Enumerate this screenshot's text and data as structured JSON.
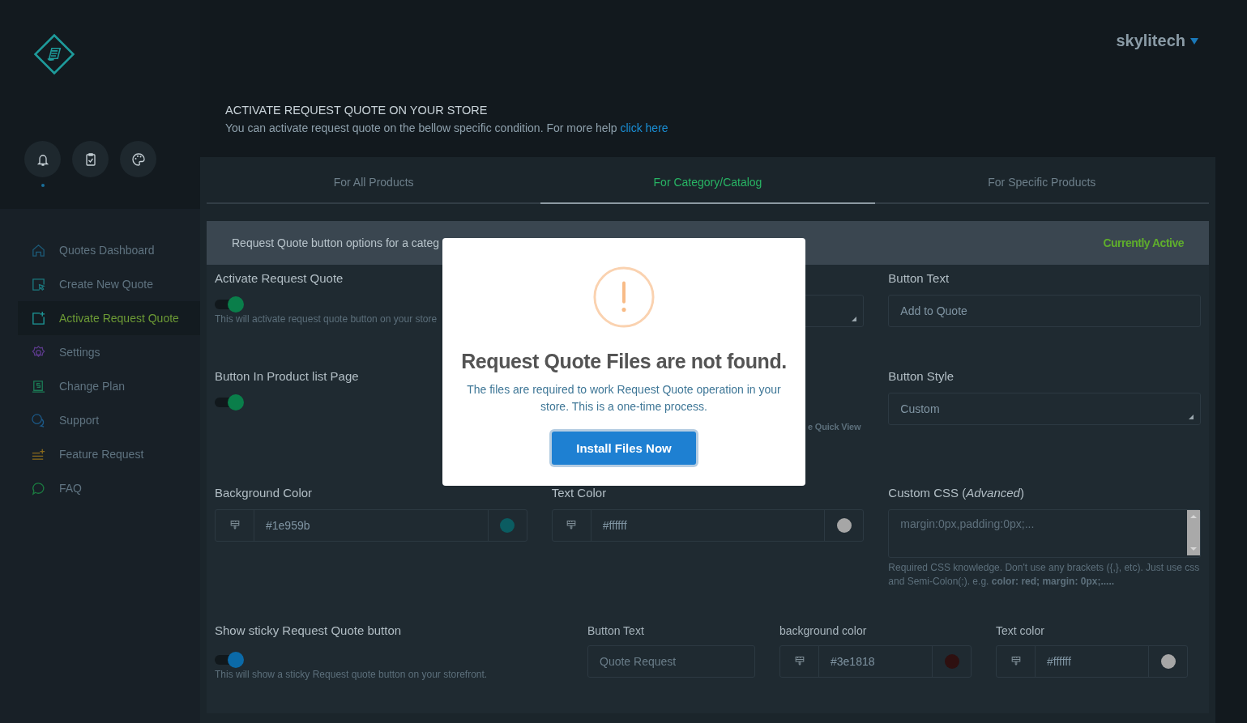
{
  "account": {
    "user": "skylitech"
  },
  "quick_actions": [
    {
      "kind": "bell",
      "notified": true
    },
    {
      "kind": "clipboard",
      "notified": false
    },
    {
      "kind": "palette",
      "notified": false
    }
  ],
  "sidebar": {
    "items": [
      {
        "label": "Quotes Dashboard",
        "kind": "home",
        "selected": false
      },
      {
        "label": "Create New Quote",
        "kind": "select",
        "selected": false
      },
      {
        "label": "Activate Request Quote",
        "kind": "adddoc",
        "selected": true
      },
      {
        "label": "Settings",
        "kind": "gear",
        "selected": false
      },
      {
        "label": "Change Plan",
        "kind": "plan",
        "selected": false
      },
      {
        "label": "Support",
        "kind": "chat",
        "selected": false
      },
      {
        "label": "Feature Request",
        "kind": "list",
        "selected": false
      },
      {
        "label": "FAQ",
        "kind": "bubble",
        "selected": false
      }
    ]
  },
  "header": {
    "title": "ACTIVATE REQUEST QUOTE ON YOUR STORE",
    "subtitle": "You can activate request quote on the bellow specific condition. For more help",
    "link": "click here"
  },
  "tabs": [
    {
      "label": "For All Products",
      "selected": false
    },
    {
      "label": "For Category/Catalog",
      "selected": true
    },
    {
      "label": "For Specific Products",
      "selected": false
    }
  ],
  "section": {
    "title": "Request Quote button options for a categ",
    "status": "Currently Active"
  },
  "settings": [
    {
      "kind": "toggle",
      "label": "Activate Request Quote",
      "on": true,
      "color": "#0a7e4a",
      "hint": "This will activate request quote button on your store"
    },
    {
      "kind": "select"
    },
    {
      "kind": "text",
      "label": "Button Text",
      "value": "Add to Quote"
    },
    {
      "kind": "toggle",
      "label": "Button In Product list Page",
      "on": true,
      "color": "#0a7e4a"
    },
    {
      "kind": "note",
      "text": "e Quick View"
    },
    {
      "kind": "select",
      "label": "Button Style",
      "value": "Custom"
    },
    {
      "kind": "color",
      "label": "Background Color",
      "value": "#1e959b",
      "color": "#0b5c61"
    },
    {
      "kind": "color",
      "label": "Text Color",
      "value": "#ffffff",
      "color": "#a6a6a6"
    },
    {
      "kind": "textarea",
      "label": "Custom CSS (*Advanced*)",
      "placeholder": "margin:0px,padding:0px;...",
      "hint": "Required CSS knowledge. Don't use any brackets ({,}, etc). Just use css and Semi-Colon(;). e.g. **color: red; margin: 0px;.....**"
    }
  ],
  "sticky": {
    "label": "Show sticky Request Quote button",
    "on": true,
    "color": "#0b6aa8",
    "hint": "This will show a sticky Request quote button on your storefront.",
    "fields": [
      {
        "kind": "text",
        "label": "Button Text",
        "placeholder": "Quote Request"
      },
      {
        "kind": "color",
        "label": "background color",
        "value": "#3e1818",
        "color": "#2e1010"
      },
      {
        "kind": "color",
        "label": "Text color",
        "value": "#ffffff",
        "color": "#a6a6a6"
      }
    ]
  },
  "modal": {
    "title": "Request Quote Files are not found.",
    "message": "The files are required to work Request Quote operation in your store. This is a one-time process.",
    "button": "Install Files Now"
  }
}
